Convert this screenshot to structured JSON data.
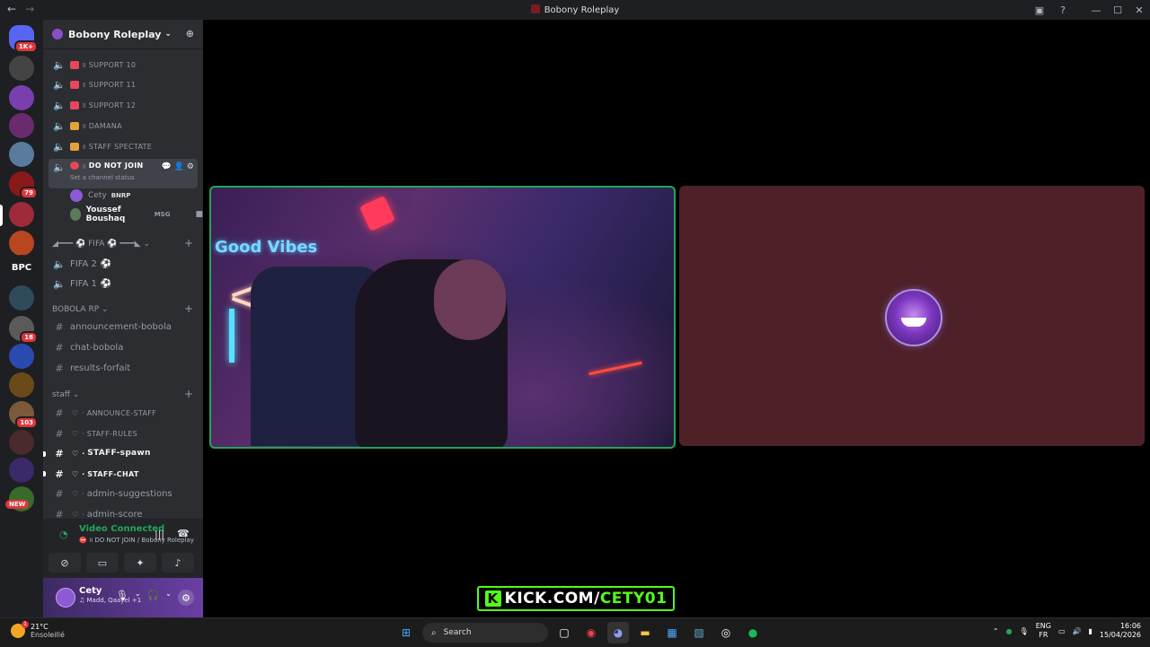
{
  "window": {
    "title": "Bobony Roleplay"
  },
  "servers": {
    "items": [
      {
        "name": "home",
        "badge": "1K+",
        "color": "#5865f2"
      },
      {
        "name": "server-2",
        "badge": "",
        "color": "#444"
      },
      {
        "name": "server-3",
        "badge": "",
        "color": "#7a3fae"
      },
      {
        "name": "server-4",
        "badge": "",
        "color": "#6a2a6e"
      },
      {
        "name": "server-5",
        "badge": "",
        "color": "#5a7a9e"
      },
      {
        "name": "server-6",
        "badge": "79",
        "color": "#8a1a1a"
      },
      {
        "name": "server-7",
        "badge": "",
        "color": "#9e2a3a"
      },
      {
        "name": "server-8",
        "badge": "",
        "color": "#b8461e"
      },
      {
        "name": "server-bpc",
        "badge": "",
        "color": "#1e1f22",
        "text": "BPC"
      },
      {
        "name": "server-10",
        "badge": "",
        "color": "#2f4a5a"
      },
      {
        "name": "server-11",
        "badge": "18",
        "color": "#5a5a5a"
      },
      {
        "name": "server-12",
        "badge": "",
        "color": "#2a4ab0"
      },
      {
        "name": "server-13",
        "badge": "",
        "color": "#6b4a1a"
      },
      {
        "name": "server-14",
        "badge": "103",
        "color": "#7a5a3a"
      },
      {
        "name": "server-15",
        "badge": "",
        "color": "#4a2a2a"
      },
      {
        "name": "server-16",
        "badge": "",
        "color": "#3a2a6a"
      },
      {
        "name": "server-17",
        "badge": "",
        "color": "#3a6a2a"
      }
    ],
    "new_label": "NEW"
  },
  "guild": {
    "name": "Bobony Roleplay"
  },
  "channels": {
    "voice": [
      {
        "label": "SUPPORT 10",
        "emoji_color": "#e8475a"
      },
      {
        "label": "SUPPORT 11",
        "emoji_color": "#e8475a"
      },
      {
        "label": "SUPPORT 12",
        "emoji_color": "#e8475a"
      },
      {
        "label": "DAMANA",
        "emoji_color": "#e3a23a"
      },
      {
        "label": "STAFF SPECTATE",
        "emoji_color": "#e3a23a"
      }
    ],
    "active": {
      "label": "DO NOT JOIN",
      "status": "Set a channel status"
    },
    "voice_users": [
      {
        "name": "Cety",
        "tag": "BNRP"
      },
      {
        "name": "Youssef Boushaq",
        "tag": "MSG"
      }
    ],
    "fifa_category": "FIFA",
    "fifa": [
      "FIFA 2",
      "FIFA 1"
    ],
    "bobola_category": "BOBOLA RP",
    "bobola": [
      "announcement-bobola",
      "chat-bobola",
      "results-forfait"
    ],
    "staff_category": "staff",
    "staff": [
      "ANNOUNCE-STAFF",
      "STAFF-RULES",
      "STAFF-spawn",
      "STAFF-CHAT",
      "admin-suggestions",
      "admin-score"
    ]
  },
  "voice_panel": {
    "title": "Video Connected",
    "subtitle": "DO NOT JOIN / Bobony Roleplay"
  },
  "user": {
    "name": "Cety",
    "status": "Madd, Qaayel +1"
  },
  "overlay": {
    "k": "K",
    "text": "KICK.COM/",
    "accent": "CETY01"
  },
  "taskbar": {
    "temp": "21°C",
    "weather": "Ensoleillé",
    "search": "Search",
    "lang1": "ENG",
    "lang2": "FR",
    "time": "16:06",
    "date": "15/04/2026",
    "weather_badge": "1"
  },
  "colors": {
    "accent_green": "#23a55a",
    "kick_green": "#53fc18",
    "tile_bg": "#4e2129"
  }
}
